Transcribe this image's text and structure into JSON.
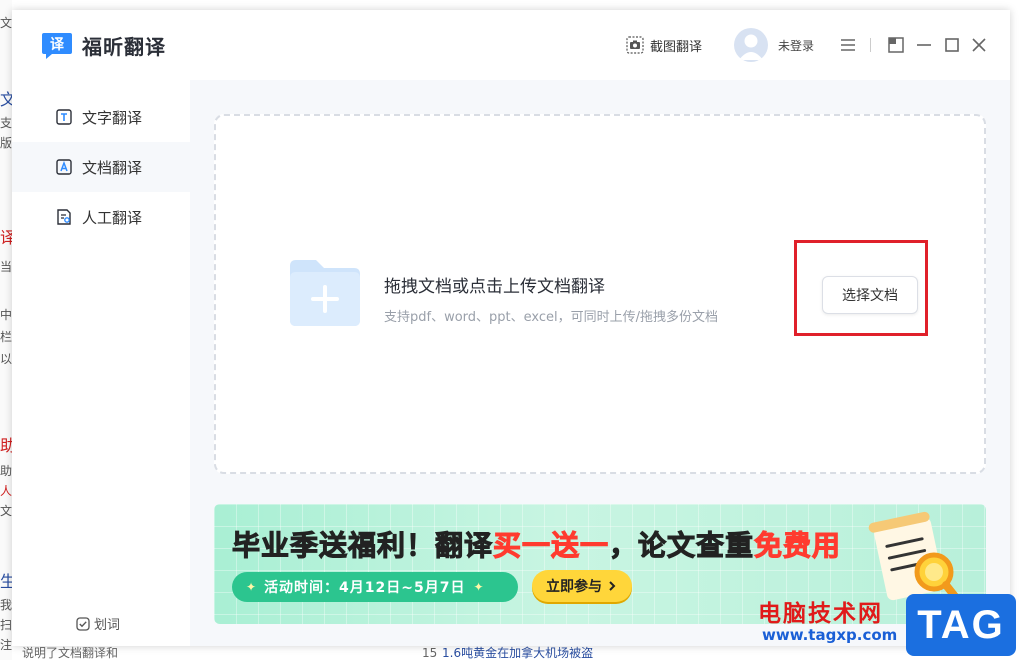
{
  "app": {
    "name": "福昕翻译",
    "logo_char": "译"
  },
  "titlebar": {
    "screenshot_translate": "截图翻译",
    "login": "未登录"
  },
  "sidebar": {
    "items": [
      {
        "label": "文字翻译",
        "icon": "text-translate-icon"
      },
      {
        "label": "文档翻译",
        "icon": "document-translate-icon"
      },
      {
        "label": "人工翻译",
        "icon": "human-translate-icon"
      }
    ],
    "active_index": 1,
    "mark_toggle": "划词"
  },
  "upload": {
    "title": "拖拽文档或点击上传文档翻译",
    "subtitle": "支持pdf、word、ppt、excel，可同时上传/拖拽多份文档",
    "choose_button": "选择文档"
  },
  "banner": {
    "head_prefix": "毕业季送福利！翻译",
    "head_highlight_1": "买一送一",
    "head_middle": "，论文查重",
    "head_highlight_2": "免费用",
    "time_label": "活动时间：4月12日~5月7日",
    "join_button": "立即参与"
  },
  "background": {
    "left_fragments": [
      "文",
      "文",
      "支",
      "版",
      "译",
      "当",
      "中",
      "栏",
      "以",
      "助",
      "助",
      "人",
      "文",
      "生",
      "我",
      "扫",
      "注"
    ],
    "bottom_left": "说明了文档翻译和",
    "bottom_item_num": "15",
    "bottom_item_text": "1.6吨黄金在加拿大机场被盗"
  },
  "watermark": {
    "text": "电脑技术网",
    "url": "www.tagxp.com",
    "tag": "TAG"
  },
  "colors": {
    "brand_blue": "#2f8cff",
    "highlight_red": "#e0202a",
    "banner_green": "#2cc58f",
    "banner_yellow": "#ffd63a"
  }
}
